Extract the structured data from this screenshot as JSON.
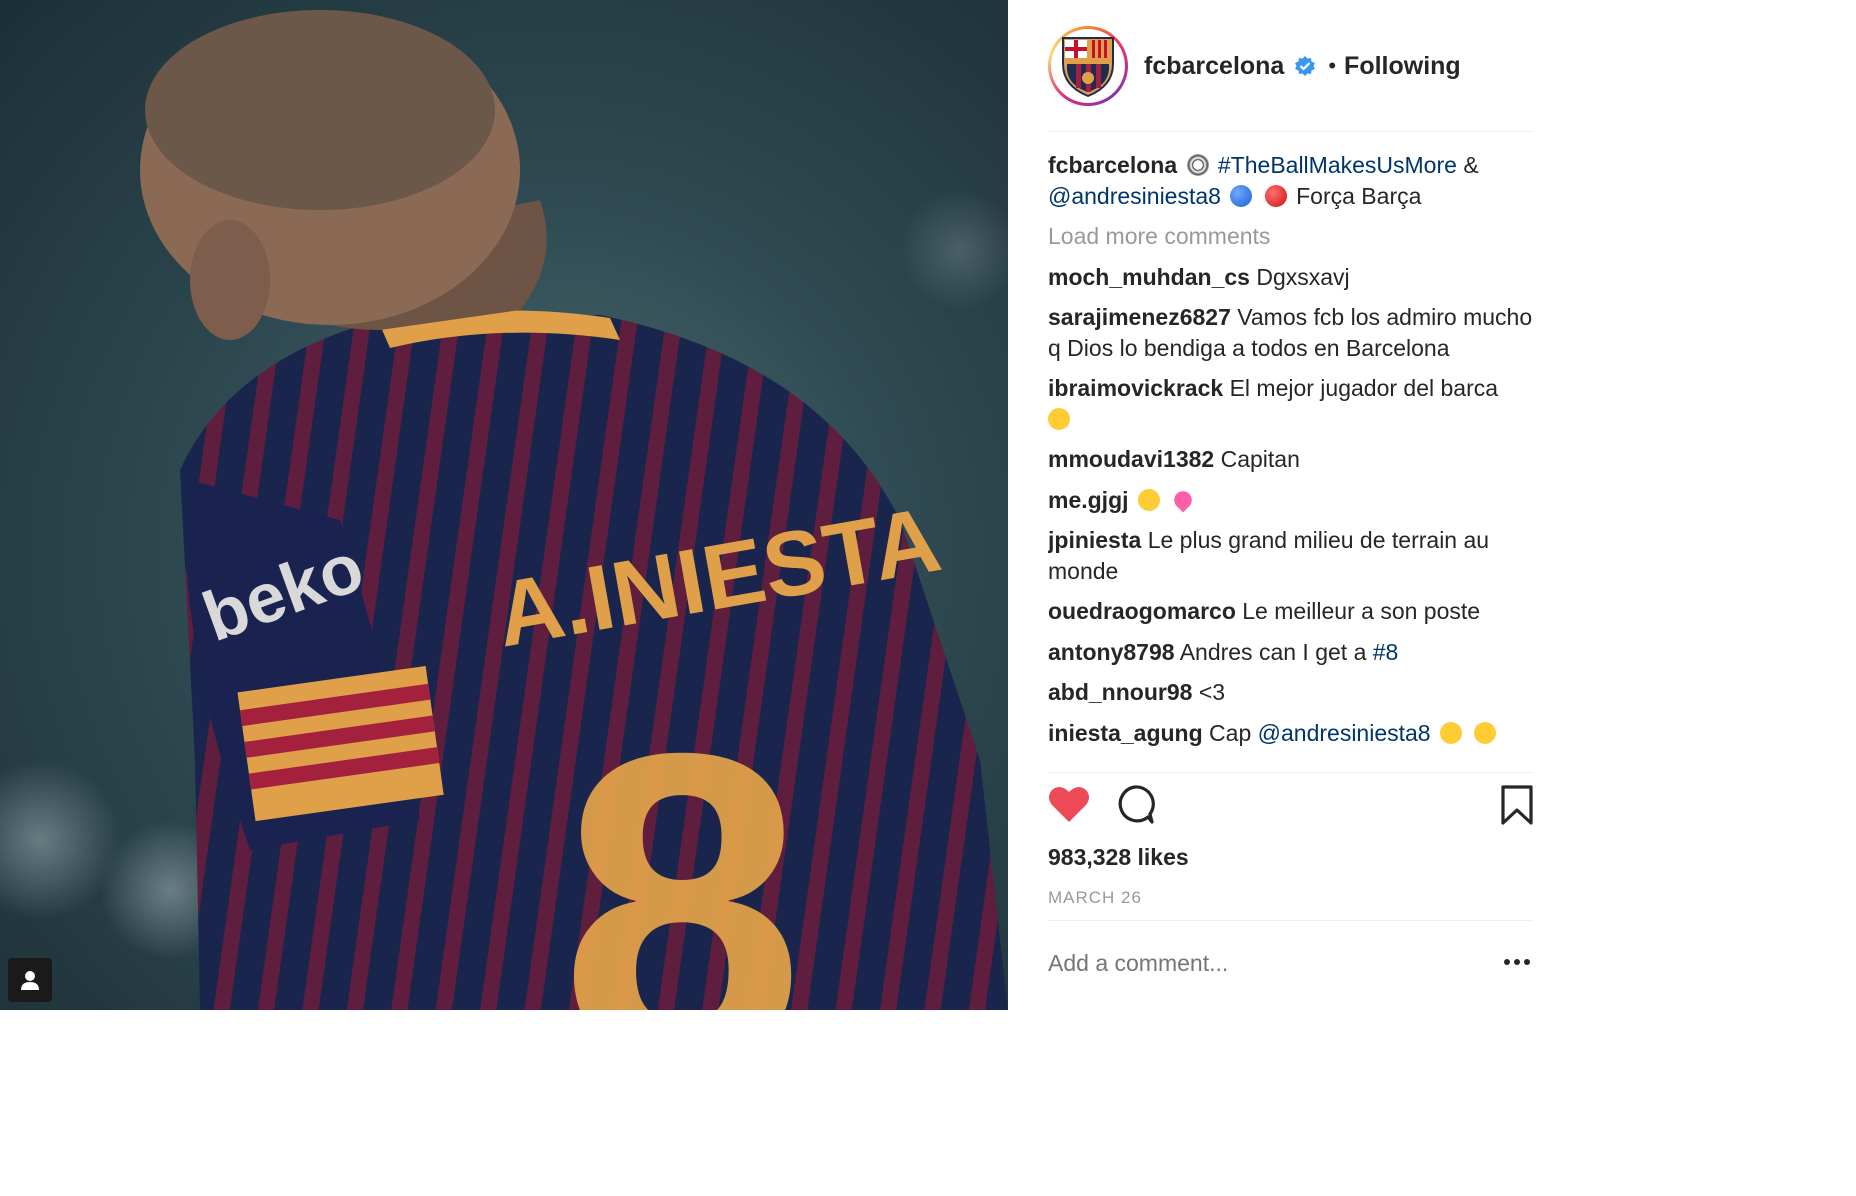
{
  "post": {
    "username": "fcbarcelona",
    "follow_status": "Following",
    "separator": "•",
    "caption": {
      "username": "fcbarcelona",
      "hashtag": "#TheBallMakesUsMore",
      "amp": "&",
      "mention": "@andresiniesta8",
      "text": "Força Barça"
    },
    "load_more": "Load more comments",
    "comments": [
      {
        "user": "moch_muhdan_cs",
        "text": "Dgxsxavj"
      },
      {
        "user": "sarajimenez6827",
        "text": "Vamos fcb los admiro mucho q Dios lo bendiga a todos en Barcelona"
      },
      {
        "user": "ibraimovickrack",
        "text": "El mejor jugador del barca"
      },
      {
        "user": "mmoudavi1382",
        "text": "Capitan"
      },
      {
        "user": "me.gjgj",
        "text": ""
      },
      {
        "user": "jpiniesta",
        "text": "Le plus grand milieu de terrain au monde"
      },
      {
        "user": "ouedraogomarco",
        "text": "Le meilleur a son poste"
      },
      {
        "user": "antony8798",
        "text": "Andres can I get a",
        "link": "#8"
      },
      {
        "user": "abd_nnour98",
        "text": "<3"
      },
      {
        "user": "iniesta_agung",
        "text": "Cap",
        "link": "@andresiniesta8"
      }
    ],
    "likes": "983,328 likes",
    "date": "MARCH 26",
    "comment_placeholder": "Add a comment...",
    "jersey": {
      "name": "A.INIESTA",
      "number": "8",
      "sponsor": "beko"
    },
    "colors": {
      "heart": "#ed4956",
      "link": "#003569",
      "muted": "#999999",
      "verified": "#3897f0",
      "jersey_navy": "#1f2a55",
      "jersey_stripe": "#8a2342",
      "gold": "#e0a04a"
    },
    "icons": {
      "tag": "user-tag-icon",
      "like": "heart-icon",
      "comment": "comment-bubble-icon",
      "save": "bookmark-icon",
      "more": "more-options-icon",
      "verified": "verified-badge-icon"
    }
  }
}
